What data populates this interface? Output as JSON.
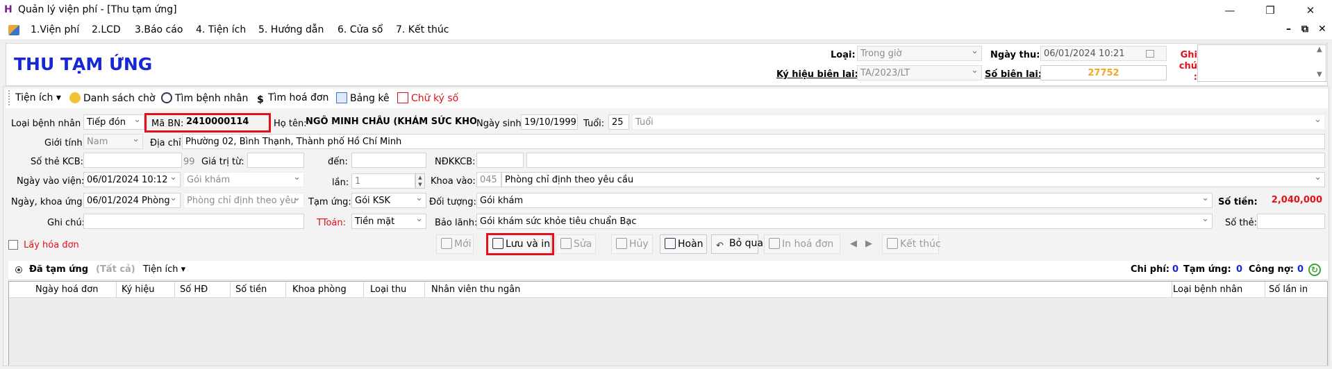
{
  "window": {
    "title": "Quản lý viện phí - [Thu tạm ứng]",
    "app_letter": "H"
  },
  "menu": [
    "1.Viện phí",
    "2.LCD",
    "3.Báo cáo",
    "4. Tiện ích",
    "5. Hướng dẫn",
    "6. Cửa sổ",
    "7. Kết thúc"
  ],
  "page_title": "THU TẠM ỨNG",
  "header": {
    "loai_label": "Loại:",
    "loai_value": "Trong giờ",
    "ngay_thu_label": "Ngày thu:",
    "ngay_thu_value": "06/01/2024 10:21",
    "ghi_chu_label": "Ghi chú :",
    "ky_hieu_label": "Ký hiệu biên lai:",
    "ky_hieu_value": "TA/2023/LT",
    "so_bien_lai_label": "Số biên lai:",
    "so_bien_lai_value": "27752"
  },
  "toolbar": {
    "tien_ich": "Tiện ích",
    "danh_sach_cho": "Danh sách chờ",
    "tim_benh_nhan": "Tìm bệnh nhân",
    "tim_hoa_don": "Tìm hoá đơn",
    "bang_ke": "Bảng kê",
    "chu_ky_so": "Chữ ký số"
  },
  "form": {
    "loai_bn_label": "Loại bệnh nhân :",
    "loai_bn_value": "Tiếp đón",
    "ma_bn_label": "Mã BN:",
    "ma_bn_value": "2410000114",
    "ho_ten_label": "Họ tên:",
    "ho_ten_value": "NGÔ MINH CHÂU (KHÁM SỨC KHOẺ)",
    "ngay_sinh_label": "Ngày sinh:",
    "ngay_sinh_value": "19/10/1999",
    "tuoi_label": "Tuổi:",
    "tuoi_value": "25",
    "tuoi_unit": "Tuổi",
    "gioi_tinh_label": "Giới tính:",
    "gioi_tinh_value": "Nam",
    "dia_chi_label": "Địa chỉ:",
    "dia_chi_value": "Phường 02, Bình Thạnh, Thành phố Hồ Chí Minh",
    "so_the_kcb_label": "Số thẻ KCB:",
    "so_the_kcb_num": "99",
    "gia_tri_tu_label": "Giá trị từ:",
    "den_label": "đến:",
    "ndkkcb_label": "NĐKKCB:",
    "ngay_vao_vien_label": "Ngày vào viện:",
    "ngay_vao_vien_value": "06/01/2024 10:12",
    "goi_kham_value": "Gói khám",
    "lan_label": "lần:",
    "lan_value": "1",
    "khoa_vao_label": "Khoa vào:",
    "khoa_vao_code": "045",
    "khoa_vao_value": "Phòng chỉ định theo yêu cầu",
    "ngay_khoa_ung_label": "Ngày, khoa ứng:",
    "ngay_khoa_ung_value": "06/01/2024 Phòng",
    "phong_value": "Phòng chỉ định theo yêu",
    "tam_ung_label": "Tạm ứng:",
    "tam_ung_value": "Gói KSK",
    "doi_tuong_label": "Đối tượng:",
    "doi_tuong_value": "Gói khám",
    "so_tien_label": "Số tiền:",
    "so_tien_value": "2,040,000",
    "ghi_chu_label": "Ghi chú:",
    "ttoan_label": "TToán:",
    "ttoan_value": "Tiền mặt",
    "bao_lanh_label": "Bảo lãnh:",
    "bao_lanh_value": "Gói khám sức khỏe tiêu chuẩn Bạc",
    "so_the_label": "Số thẻ:",
    "lay_hoa_don": "Lấy hóa đơn"
  },
  "actions": {
    "moi": "Mới",
    "luu_va_in": "Lưu và in",
    "sua": "Sửa",
    "huy": "Hủy",
    "hoan": "Hoàn",
    "bo_qua": "Bỏ qua",
    "in_hoa_don": "In hoá đơn",
    "ket_thuc": "Kết thúc"
  },
  "grid": {
    "tab_label": "Đã tạm ứng",
    "tab_all": "(Tất cả)",
    "tab_tien_ich": "Tiện ích",
    "chi_phi_label": "Chi phí:",
    "chi_phi_value": "0",
    "tam_ung_label": "Tạm ứng:",
    "tam_ung_value": "0",
    "cong_no_label": "Công nợ:",
    "cong_no_value": "0",
    "columns": [
      "Ngày hoá đơn",
      "Ký hiệu",
      "Số HĐ",
      "Số tiền",
      "Khoa phòng",
      "Loại thu",
      "Nhân viên thu ngân",
      "Loại bệnh nhân",
      "Số lần in"
    ]
  },
  "colors": {
    "title_blue": "#1628d6",
    "highlight_red": "#e3101b",
    "amount_red": "#e3101b",
    "receipt_orange": "#f5a623"
  }
}
